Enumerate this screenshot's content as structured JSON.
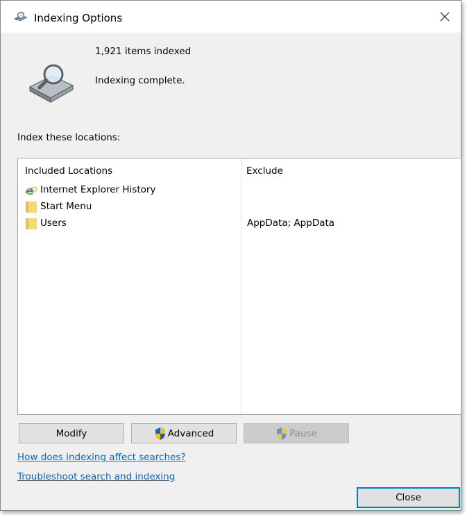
{
  "window": {
    "title": "Indexing Options",
    "title_icon": "search-index-icon",
    "close_icon": "close-icon"
  },
  "status": {
    "items_indexed": "1,921 items indexed",
    "state": "Indexing complete.",
    "icon": "indexing-drive-icon"
  },
  "section_label": "Index these locations:",
  "table": {
    "headers": {
      "included": "Included Locations",
      "exclude": "Exclude"
    },
    "rows": [
      {
        "name": "Internet Explorer History",
        "exclude": "",
        "icon": "internet-explorer-icon"
      },
      {
        "name": "Start Menu",
        "exclude": "",
        "icon": "folder-icon"
      },
      {
        "name": "Users",
        "exclude": "AppData; AppData",
        "icon": "folder-icon"
      }
    ]
  },
  "buttons": {
    "modify": "Modify",
    "advanced": "Advanced",
    "pause": "Pause",
    "close": "Close"
  },
  "links": {
    "help": "How does indexing affect searches?",
    "troubleshoot": "Troubleshoot search and indexing"
  },
  "colors": {
    "accent": "#0078d7",
    "link": "#0066cc",
    "folder": "#f8d775"
  }
}
